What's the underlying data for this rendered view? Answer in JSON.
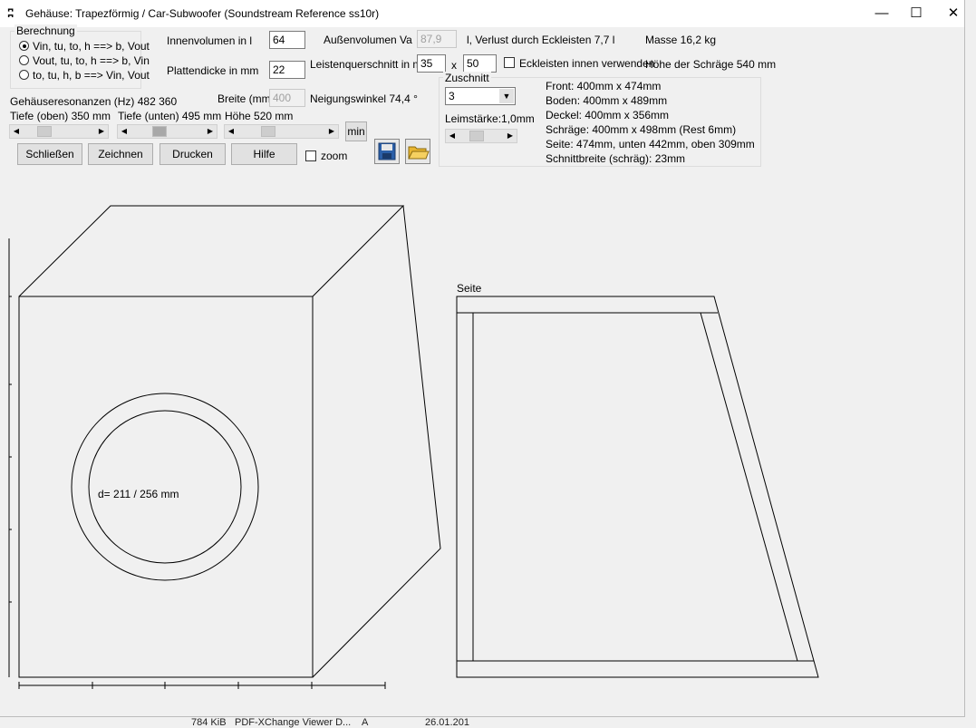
{
  "window": {
    "title": "Gehäuse: Trapezförmig / Car-Subwoofer (Soundstream Reference ss10r)",
    "icon": "speaker-app-icon",
    "minimize": "—",
    "maximize": "☐",
    "close": "✕"
  },
  "berechnung": {
    "title": "Berechnung",
    "options": [
      "Vin, tu, to, h ==>  b, Vout",
      "Vout, tu, to, h ==> b, Vin",
      "to, tu, h, b ==> Vin, Vout"
    ],
    "selected": 0
  },
  "inputs": {
    "innenvolumen_label": "Innenvolumen in l",
    "innenvolumen_value": "64",
    "plattendicke_label": "Plattendicke in mm",
    "plattendicke_value": "22",
    "aussenvolumen_label": "Außenvolumen Va",
    "aussenvolumen_value": "87,9",
    "verlust_text": "l,  Verlust durch Eckleisten 7,7 l",
    "masse_text": "Masse 16,2 kg",
    "leisten_label": "Leistenquerschnitt in mm",
    "leisten_a": "35",
    "leisten_x": "x",
    "leisten_b": "50",
    "eckleisten_label": "Eckleisten innen verwenden",
    "hoehe_schraege": "Höhe der Schräge 540 mm",
    "breite_label": "Breite (mm)",
    "breite_value": "400",
    "neigung": "Neigungswinkel 74,4 °",
    "resonanzen": "Gehäuseresonanzen (Hz) 482  360",
    "tiefe_oben": "Tiefe (oben) 350 mm",
    "tiefe_unten": "Tiefe (unten) 495 mm",
    "hoehe": "Höhe 520 mm",
    "min_label": "min",
    "zoom_label": "zoom"
  },
  "buttons": {
    "schliessen": "Schließen",
    "zeichnen": "Zeichnen",
    "drucken": "Drucken",
    "hilfe": "Hilfe"
  },
  "zuschnitt": {
    "title": "Zuschnitt",
    "select_value": "3",
    "leimstaerke": "Leimstärke:1,0mm",
    "lines": [
      "Front: 400mm x 474mm",
      "Boden: 400mm x 489mm",
      "Deckel: 400mm x 356mm",
      "Schräge: 400mm x 498mm (Rest 6mm)",
      "Seite: 474mm, unten 442mm, oben 309mm",
      "Schnittbreite (schräg): 23mm"
    ]
  },
  "drawing": {
    "diameter_label": "d= 211 / 256 mm",
    "seite_label": "Seite"
  },
  "taskbar": {
    "size": "784 KiB",
    "app": "PDF-XChange Viewer D...",
    "a": "A",
    "date": "26.01.201"
  }
}
